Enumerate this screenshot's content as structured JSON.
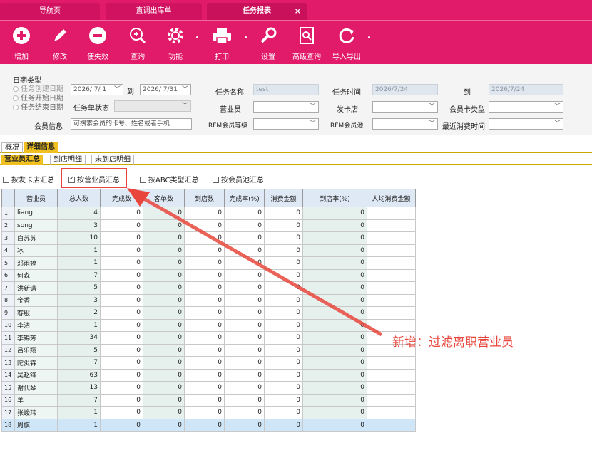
{
  "tabs": [
    {
      "label": "导航页"
    },
    {
      "label": "直调出库单"
    },
    {
      "label": "任务报表"
    }
  ],
  "toolbar": {
    "add": "增加",
    "edit": "修改",
    "disable": "使失效",
    "query": "查询",
    "func": "功能",
    "print": "打印",
    "settings": "设置",
    "advanced": "高级查询",
    "import_export": "导入导出"
  },
  "filter": {
    "date_type_label": "日期类型",
    "radio1": "任务创建日期",
    "radio2": "任务开始日期",
    "radio3": "任务结束日期",
    "date_from": "2026/ 7/ 1",
    "to_label": "到",
    "date_to": "2026/ 7/31",
    "task_status_label": "任务单状态",
    "member_info_label": "会员信息",
    "member_info_placeholder": "可搜索会员的卡号、姓名或者手机",
    "task_name_label": "任务名称",
    "task_name_value": "test",
    "clerk_label": "营业员",
    "rfm_level_label": "RFM会员等级",
    "task_time_label": "任务时间",
    "task_time_from": "2026/7/24",
    "task_time_to_label": "到",
    "task_time_to": "2026/7/24",
    "card_store_label": "发卡店",
    "rfm_pool_label": "RFM会员池",
    "card_type_label": "会员卡类型",
    "last_consume_label": "最近消费时间"
  },
  "tabs2": [
    "概况",
    "详细信息"
  ],
  "tabs3": [
    "营业员汇总",
    "到店明细",
    "未到店明细"
  ],
  "checks": [
    {
      "label": "按发卡店汇总",
      "checked": false
    },
    {
      "label": "按营业员汇总",
      "checked": true
    },
    {
      "label": "按ABC类型汇总",
      "checked": false
    },
    {
      "label": "按会员池汇总",
      "checked": false
    }
  ],
  "columns": [
    "营业员",
    "总人数",
    "完成数",
    "客单数",
    "到店数",
    "完成率(%)",
    "消费金额",
    "到店率(%)",
    "人均消费金额"
  ],
  "rows": [
    [
      "1",
      "liang",
      "4",
      "0",
      "0",
      "0",
      "0",
      "0",
      "0",
      ""
    ],
    [
      "2",
      "song",
      "3",
      "0",
      "0",
      "0",
      "0",
      "0",
      "0",
      ""
    ],
    [
      "3",
      "白苏苏",
      "10",
      "0",
      "0",
      "0",
      "0",
      "0",
      "0",
      ""
    ],
    [
      "4",
      "冰",
      "1",
      "0",
      "0",
      "0",
      "0",
      "0",
      "0",
      ""
    ],
    [
      "5",
      "邓雨婷",
      "1",
      "0",
      "0",
      "0",
      "0",
      "0",
      "0",
      ""
    ],
    [
      "6",
      "何森",
      "7",
      "0",
      "0",
      "0",
      "0",
      "0",
      "0",
      ""
    ],
    [
      "7",
      "洪新谱",
      "5",
      "0",
      "0",
      "0",
      "0",
      "0",
      "0",
      ""
    ],
    [
      "8",
      "金香",
      "3",
      "0",
      "0",
      "0",
      "0",
      "0",
      "0",
      ""
    ],
    [
      "9",
      "客服",
      "2",
      "0",
      "0",
      "0",
      "0",
      "0",
      "0",
      ""
    ],
    [
      "10",
      "李浩",
      "1",
      "0",
      "0",
      "0",
      "0",
      "0",
      "0",
      ""
    ],
    [
      "11",
      "李锦芳",
      "34",
      "0",
      "0",
      "0",
      "0",
      "0",
      "0",
      ""
    ],
    [
      "12",
      "吕乐翔",
      "5",
      "0",
      "0",
      "0",
      "0",
      "0",
      "0",
      ""
    ],
    [
      "13",
      "陀炎霖",
      "7",
      "0",
      "0",
      "0",
      "0",
      "0",
      "0",
      ""
    ],
    [
      "14",
      "吴赵锋",
      "63",
      "0",
      "0",
      "0",
      "0",
      "0",
      "0",
      ""
    ],
    [
      "15",
      "谢代琴",
      "13",
      "0",
      "0",
      "0",
      "0",
      "0",
      "0",
      ""
    ],
    [
      "16",
      "羊",
      "7",
      "0",
      "0",
      "0",
      "0",
      "0",
      "0",
      ""
    ],
    [
      "17",
      "张峻玮",
      "1",
      "0",
      "0",
      "0",
      "0",
      "0",
      "0",
      ""
    ],
    [
      "18",
      "周旗",
      "1",
      "0",
      "0",
      "0",
      "0",
      "0",
      "0",
      ""
    ]
  ],
  "annotation": "新增：过滤离职营业员",
  "colors": {
    "brand": "#e11a6a",
    "annotation": "#e8463c",
    "accent_tab": "#f0c020"
  }
}
